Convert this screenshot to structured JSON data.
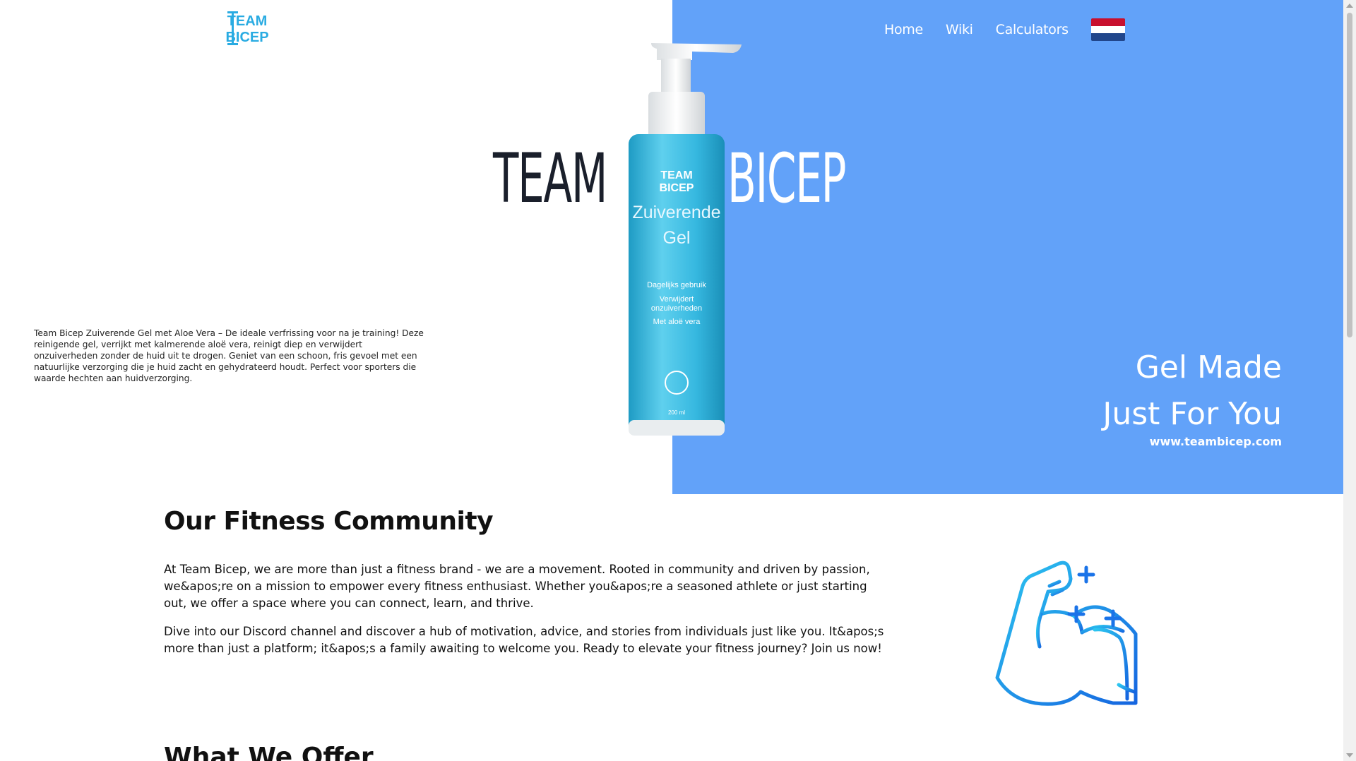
{
  "nav": {
    "logo_text_line1": "TEAM",
    "logo_text_line2": "BICEP",
    "items": [
      {
        "label": "Home"
      },
      {
        "label": "Wiki"
      },
      {
        "label": "Calculators"
      }
    ],
    "flag_icon": "netherlands-flag-icon"
  },
  "hero": {
    "word_left": "TEAM",
    "word_right": "BICEP",
    "description": "Team Bicep Zuiverende Gel met Aloe Vera – De ideale verfrissing voor na je training! Deze reinigende gel, verrijkt met kalmerende aloë vera, reinigt diep en verwijdert onzuiverheden zonder de huid uit te drogen. Geniet van een schoon, fris gevoel met een natuurlijke verzorging die je huid zacht en gehydrateerd houdt. Perfect voor sporters die waarde hechten aan huidverzorging.",
    "tagline_line1": "Gel Made",
    "tagline_line2": "Just For You",
    "url": "www.teambicep.com",
    "bottle": {
      "brand_line1": "TEAM",
      "brand_line2": "BICEP",
      "name_line1": "Zuiverende",
      "name_line2": "Gel",
      "feature1": "Dagelijks gebruik",
      "feature2_line1": "Verwijdert",
      "feature2_line2": "onzuiverheden",
      "feature3": "Met aloë vera",
      "volume": "200 ml"
    }
  },
  "community": {
    "title": "Our Fitness Community",
    "paragraph1": "At Team Bicep, we are more than just a fitness brand - we are a movement. Rooted in community and driven by passion, we&apos;re on a mission to empower every fitness enthusiast. Whether you&apos;re a seasoned athlete or just starting out, we offer a space where you can connect, learn, and thrive.",
    "paragraph2": "Dive into our Discord channel and discover a hub of motivation, advice, and stories from individuals just like you. It&apos;s more than just a platform; it&apos;s a family awaiting to welcome you. Ready to elevate your fitness journey? Join us now!",
    "icon": "flexed-bicep-icon"
  },
  "offer": {
    "title": "What We Offer"
  },
  "colors": {
    "hero_blue": "#62a2f9",
    "logo_blue": "#29abe2",
    "flag_red": "#c8102e",
    "flag_white": "#ffffff",
    "flag_blue": "#21468b"
  }
}
